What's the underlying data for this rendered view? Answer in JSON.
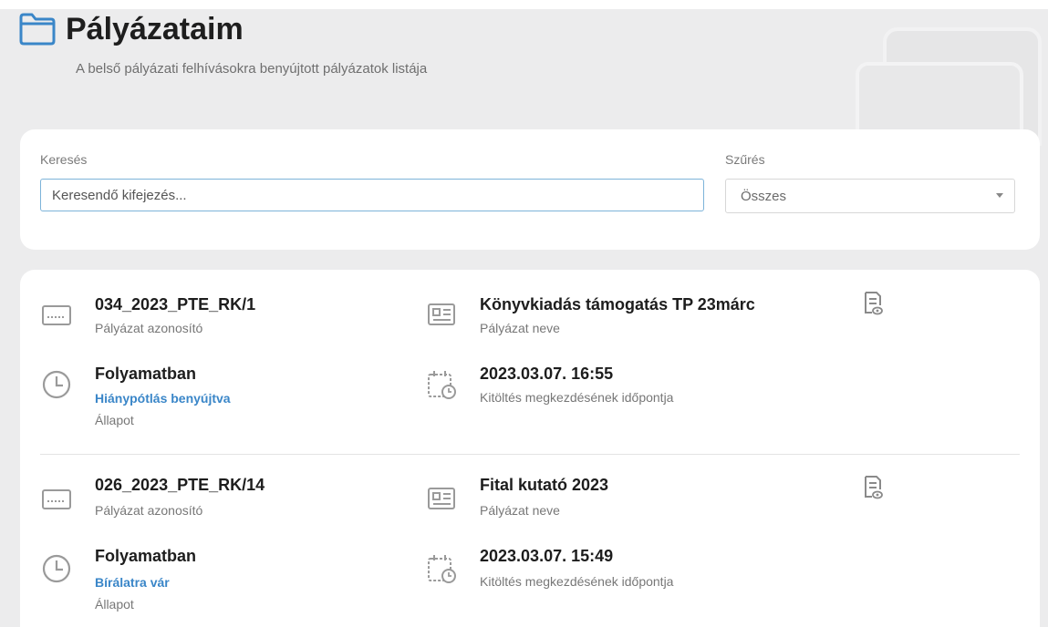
{
  "header": {
    "title": "Pályázataim",
    "subtitle": "A belső pályázati felhívásokra benyújtott pályázatok listája",
    "icon": "folder-icon"
  },
  "search": {
    "label": "Keresés",
    "placeholder": "Keresendő kifejezés...",
    "value": ""
  },
  "filter": {
    "label": "Szűrés",
    "selected": "Összes"
  },
  "colors": {
    "accent": "#3a86c8",
    "background": "#ececed",
    "card": "#ffffff"
  },
  "applications": [
    {
      "id": "034_2023_PTE_RK/1",
      "id_label": "Pályázat azonosító",
      "name": "Könyvkiadás támogatás TP 23márc",
      "name_label": "Pályázat neve",
      "status": "Folyamatban",
      "status_sub": "Hiánypótlás benyújtva",
      "status_label": "Állapot",
      "date": "2023.03.07. 16:55",
      "date_label": "Kitöltés megkezdésének időpontja"
    },
    {
      "id": "026_2023_PTE_RK/14",
      "id_label": "Pályázat azonosító",
      "name": "Fital kutató 2023",
      "name_label": "Pályázat neve",
      "status": "Folyamatban",
      "status_sub": "Bírálatra vár",
      "status_label": "Állapot",
      "date": "2023.03.07. 15:49",
      "date_label": "Kitöltés megkezdésének időpontja"
    }
  ]
}
